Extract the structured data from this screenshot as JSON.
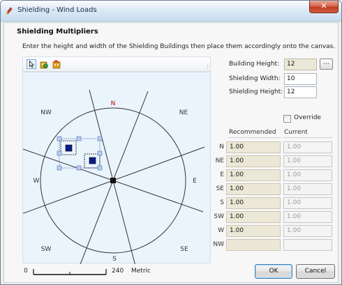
{
  "window": {
    "title": "Shielding - Wind Loads",
    "close_icon": "close-icon"
  },
  "heading": "Shielding Multipliers",
  "instructions": "Enter the height and width of the Shielding Buildings then place them accordingly onto the canvas.",
  "toolbar": {
    "tools": [
      "pointer-icon",
      "building-icon",
      "building-add-icon"
    ]
  },
  "compass": {
    "labels": {
      "N": "N",
      "NE": "NE",
      "E": "E",
      "SE": "SE",
      "S": "S",
      "SW": "SW",
      "W": "W",
      "NW": "NW"
    },
    "north_color": "#cc0000"
  },
  "scale": {
    "start": "0",
    "end": "240",
    "unit": "Metric"
  },
  "fields": {
    "building_height_label": "Building Height:",
    "building_height_value": "12",
    "browse_label": "...",
    "shielding_width_label": "Shielding Width:",
    "shielding_width_value": "10",
    "shielding_height_label": "Shielding Height:",
    "shielding_height_value": "12"
  },
  "override": {
    "label": "Override",
    "checked": false
  },
  "table": {
    "recommended_header": "Recommended",
    "current_header": "Current",
    "rows": [
      {
        "dir": "N",
        "recommended": "1.00",
        "current": "1.00"
      },
      {
        "dir": "NE",
        "recommended": "1.00",
        "current": "1.00"
      },
      {
        "dir": "E",
        "recommended": "1.00",
        "current": "1.00"
      },
      {
        "dir": "SE",
        "recommended": "1.00",
        "current": "1.00"
      },
      {
        "dir": "S",
        "recommended": "1.00",
        "current": "1.00"
      },
      {
        "dir": "SW",
        "recommended": "1.00",
        "current": "1.00"
      },
      {
        "dir": "W",
        "recommended": "1.00",
        "current": "1.00"
      },
      {
        "dir": "NW",
        "recommended": "",
        "current": ""
      }
    ]
  },
  "buttons": {
    "ok": "OK",
    "cancel": "Cancel"
  }
}
